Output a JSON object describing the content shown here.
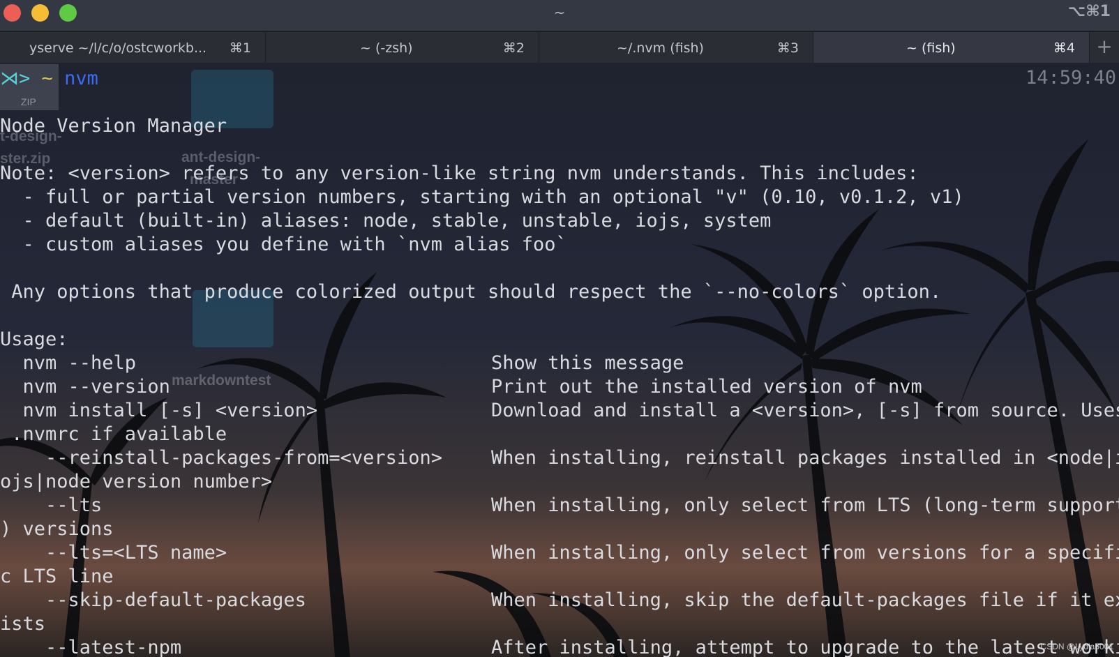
{
  "window": {
    "title": "~",
    "shortcut": "⌥⌘1"
  },
  "tabs": [
    {
      "label": "yserve ~/l/c/o/ostcworkb...",
      "shortcut": "⌘1",
      "active": false
    },
    {
      "label": "~ (-zsh)",
      "shortcut": "⌘2",
      "active": false
    },
    {
      "label": "~/.nvm (fish)",
      "shortcut": "⌘3",
      "active": false
    },
    {
      "label": "~ (fish)",
      "shortcut": "⌘4",
      "active": true
    }
  ],
  "new_tab_label": "+",
  "prompt": {
    "symbol": "⋊>",
    "dir": "~",
    "command": "nvm",
    "time": "14:59:40"
  },
  "output_lines": [
    "Node Version Manager",
    "",
    "Note: <version> refers to any version-like string nvm understands. This includes:",
    "  - full or partial version numbers, starting with an optional \"v\" (0.10, v0.1.2, v1)",
    "  - default (built-in) aliases: node, stable, unstable, iojs, system",
    "  - custom aliases you define with `nvm alias foo`",
    "",
    " Any options that produce colorized output should respect the `--no-colors` option.",
    "",
    "Usage:"
  ],
  "usage_rows": [
    {
      "cmd": "  nvm --help",
      "desc": "Show this message"
    },
    {
      "cmd": "  nvm --version",
      "desc": "Print out the installed version of nvm"
    },
    {
      "cmd": "  nvm install [-s] <version>",
      "desc": "Download and install a <version>, [-s] from source. Uses"
    },
    {
      "cmd": " .nvmrc if available",
      "desc": ""
    },
    {
      "cmd": "    --reinstall-packages-from=<version>",
      "desc": "When installing, reinstall packages installed in <node|i"
    },
    {
      "cmd": "ojs|node version number>",
      "desc": ""
    },
    {
      "cmd": "    --lts",
      "desc": "When installing, only select from LTS (long-term support"
    },
    {
      "cmd": ") versions",
      "desc": ""
    },
    {
      "cmd": "    --lts=<LTS name>",
      "desc": "When installing, only select from versions for a specifi"
    },
    {
      "cmd": "c LTS line",
      "desc": ""
    },
    {
      "cmd": "    --skip-default-packages",
      "desc": "When installing, skip the default-packages file if it ex"
    },
    {
      "cmd": "ists",
      "desc": ""
    },
    {
      "cmd": "    --latest-npm",
      "desc": "After installing, attempt to upgrade to the latest worki"
    }
  ],
  "desktop_icons": {
    "zip_badge": "ZIP",
    "file1_label_a": "t-design-",
    "file1_label_b": "ster.zip",
    "file2_label_a": "ant-design-",
    "file2_label_b": "master",
    "file3_label": "markdowntest"
  },
  "watermark": "CSDN @Lydia5001",
  "colors": {
    "prompt_symbol": "#5ad0d8",
    "prompt_dir": "#d8c44c",
    "prompt_command": "#3d6cf2",
    "text": "#d9dbe0"
  }
}
